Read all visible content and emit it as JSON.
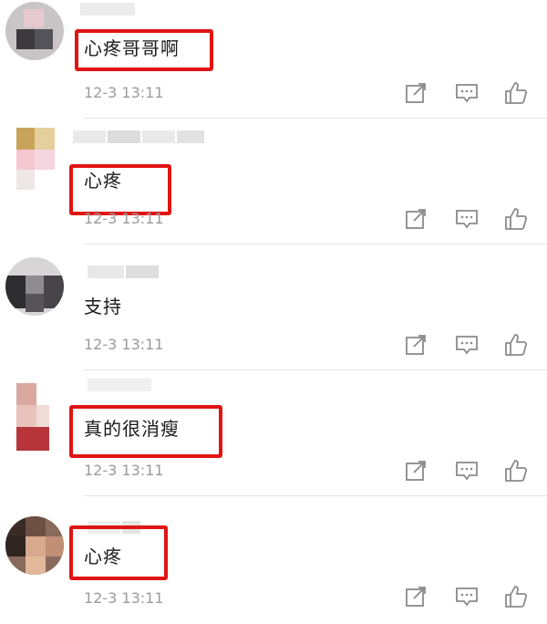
{
  "comments": [
    {
      "text": "心疼哥哥啊",
      "time": "12-3 13:11",
      "highlighted": true
    },
    {
      "text": "心疼",
      "time": "12-3 13:11",
      "highlighted": true
    },
    {
      "text": "支持",
      "time": "12-3 13:11",
      "highlighted": false
    },
    {
      "text": "真的很消瘦",
      "time": "12-3 13:11",
      "highlighted": true
    },
    {
      "text": "心疼",
      "time": "12-3 13:11",
      "highlighted": true
    }
  ],
  "icons": {
    "share": "share-icon",
    "reply": "comment-icon",
    "like": "thumbs-up-icon"
  },
  "colors": {
    "highlight": "#e11414",
    "time": "#9b9b9b",
    "text": "#1a1a1a",
    "divider": "#e6e6e6"
  }
}
